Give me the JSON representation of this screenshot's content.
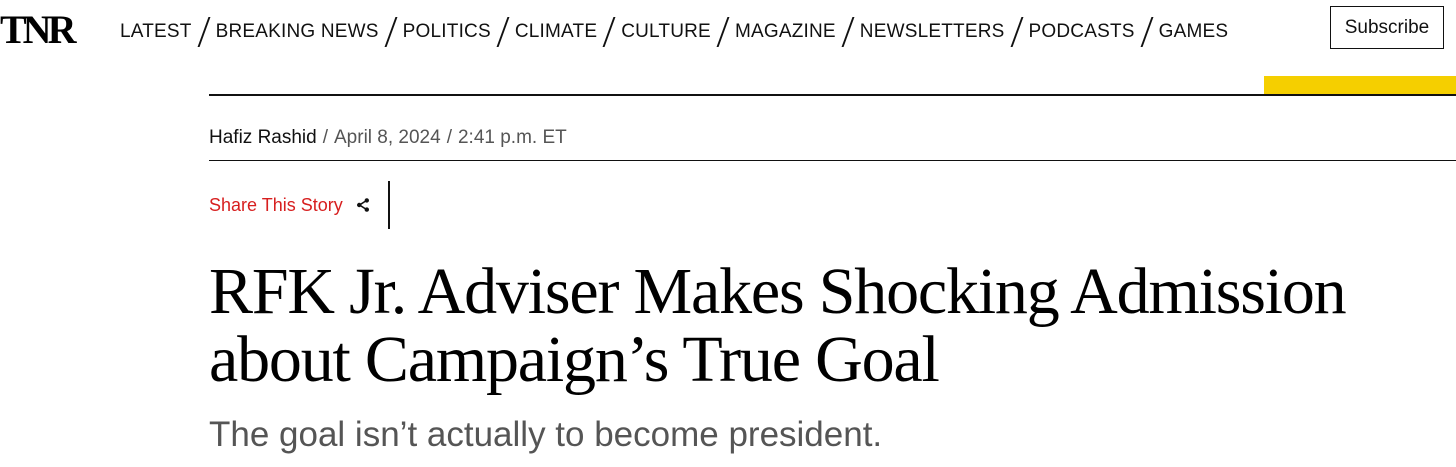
{
  "header": {
    "logo": "TNR",
    "nav": [
      "LATEST",
      "BREAKING NEWS",
      "POLITICS",
      "CLIMATE",
      "CULTURE",
      "MAGAZINE",
      "NEWSLETTERS",
      "PODCASTS",
      "GAMES"
    ],
    "subscribe_label": "Subscribe"
  },
  "colors": {
    "accent_yellow": "#f5cf00",
    "share_red": "#d71f1f"
  },
  "byline": {
    "author": "Hafiz Rashid",
    "date": "April 8, 2024",
    "time": "2:41 p.m. ET",
    "separator": "/"
  },
  "share": {
    "label": "Share This Story",
    "icon": "share-icon"
  },
  "article": {
    "headline_line_1": "RFK Jr. Adviser Makes Shocking Admission",
    "headline_line_2": "about Campaign’s True Goal",
    "dek": "The goal isn’t actually to become president."
  }
}
